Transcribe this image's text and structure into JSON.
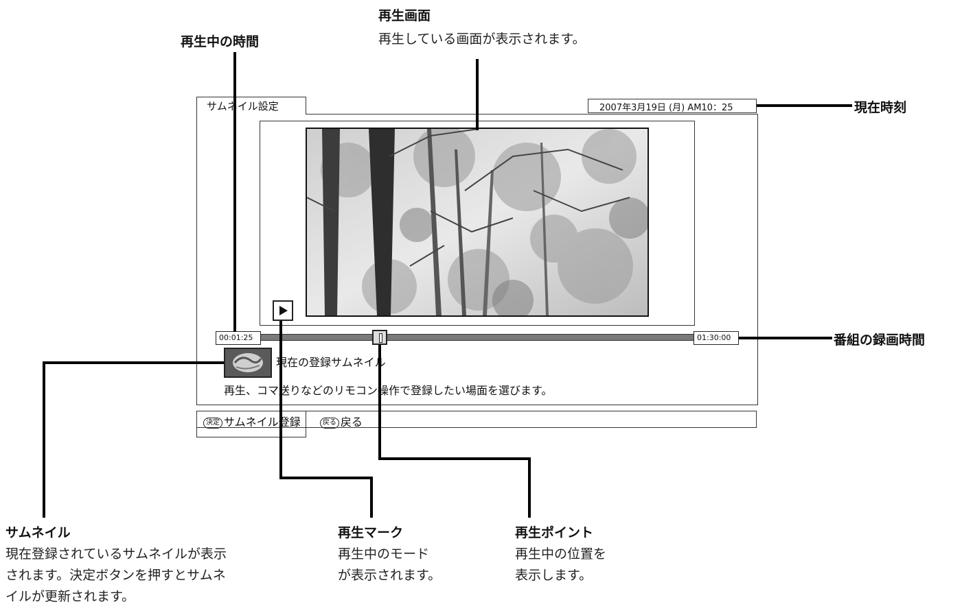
{
  "screen": {
    "tab_title": "サムネイル設定",
    "clock": "2007年3月19日 (月) AM10：25",
    "time_current": "00:01:25",
    "time_total": "01:30:00",
    "thumbnail_label": "現在の登録サムネイル",
    "instruction": "再生、コマ送りなどのリモコン操作で登録したい場面を選びます。",
    "footer": {
      "ok_key": "決定",
      "ok_label": "サムネイル登録",
      "back_key": "戻る",
      "back_label": "戻る"
    }
  },
  "callouts": {
    "playback_time": {
      "title": "再生中の時間"
    },
    "playback_screen": {
      "title": "再生画面",
      "desc": "再生している画面が表示されます。"
    },
    "current_time": {
      "title": "現在時刻"
    },
    "recording_time": {
      "title": "番組の録画時間"
    },
    "thumbnail": {
      "title": "サムネイル",
      "desc_lines": [
        "現在登録されているサムネイルが表示",
        "されます。決定ボタンを押すとサムネ",
        "イルが更新されます。"
      ]
    },
    "play_mark": {
      "title": "再生マーク",
      "desc_lines": [
        "再生中のモード",
        "が表示されます。"
      ]
    },
    "play_point": {
      "title": "再生ポイント",
      "desc_lines": [
        "再生中の位置を",
        "表示します。"
      ]
    }
  },
  "colors": {
    "line": "#000000",
    "track": "#7a7a7a"
  }
}
